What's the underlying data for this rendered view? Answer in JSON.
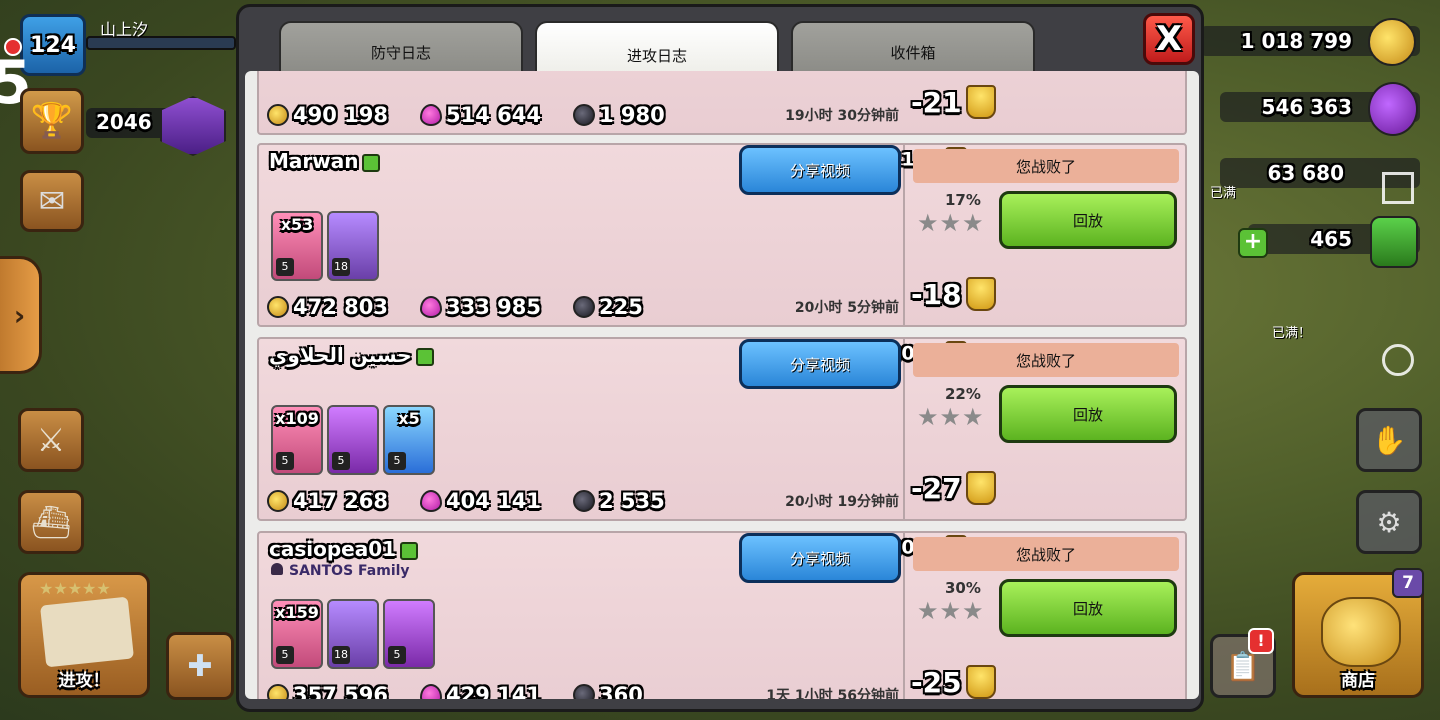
{
  "hud": {
    "player_level": "124",
    "player_name": "山上汐",
    "trophies": "2046",
    "side_notification": "5",
    "attack_label": "进攻！",
    "shop_label": "商店",
    "shop_badge": "7",
    "alert_badge": "!",
    "full_label": "已满",
    "full_label_2": "已满！"
  },
  "resources": {
    "gold": "1 018 799",
    "elixir": "546 363",
    "dark_elixir": "63 680",
    "gems": "465"
  },
  "tabs": [
    {
      "label": "防守日志"
    },
    {
      "label": "进攻日志"
    },
    {
      "label": "收件箱"
    }
  ],
  "close_label": "X",
  "entries_top": {
    "gold": "490 198",
    "elixir": "514 644",
    "dark": "1 980",
    "time": "19小时 30分钟前",
    "trophy_delta": "-21"
  },
  "entries": [
    {
      "name": "Marwan",
      "clan": "",
      "trophies": "2188",
      "share_label": "分享视频",
      "result": "您战败了",
      "percent": "17%",
      "stars": 0,
      "replay_label": "回放",
      "trophy_delta": "-18",
      "troops": [
        {
          "type": "archer",
          "qty": "x53",
          "level": "5"
        },
        {
          "type": "queen",
          "qty": "",
          "level": "18"
        }
      ],
      "gold": "472 803",
      "elixir": "333 985",
      "dark": "225",
      "time": "20小时 5分钟前"
    },
    {
      "name": "حسين الحلاوي",
      "clan": "",
      "trophies": "2016",
      "share_label": "分享视频",
      "result": "您战败了",
      "percent": "22%",
      "stars": 0,
      "replay_label": "回放",
      "trophy_delta": "-27",
      "troops": [
        {
          "type": "archer",
          "qty": "x109",
          "level": "5"
        },
        {
          "type": "warden",
          "qty": "",
          "level": "5"
        },
        {
          "type": "spell",
          "qty": "x5",
          "level": "5"
        }
      ],
      "gold": "417 268",
      "elixir": "404 141",
      "dark": "2 535",
      "time": "20小时 19分钟前"
    },
    {
      "name": "casiopea01",
      "clan": "SANTOS Family",
      "trophies": "2099",
      "share_label": "分享视频",
      "result": "您战败了",
      "percent": "30%",
      "stars": 0,
      "replay_label": "回放",
      "trophy_delta": "-25",
      "troops": [
        {
          "type": "archer",
          "qty": "x159",
          "level": "5"
        },
        {
          "type": "queen",
          "qty": "",
          "level": "18"
        },
        {
          "type": "warden",
          "qty": "",
          "level": "5"
        }
      ],
      "gold": "357 596",
      "elixir": "429 141",
      "dark": "360",
      "time": "1天 1小时 56分钟前"
    }
  ]
}
